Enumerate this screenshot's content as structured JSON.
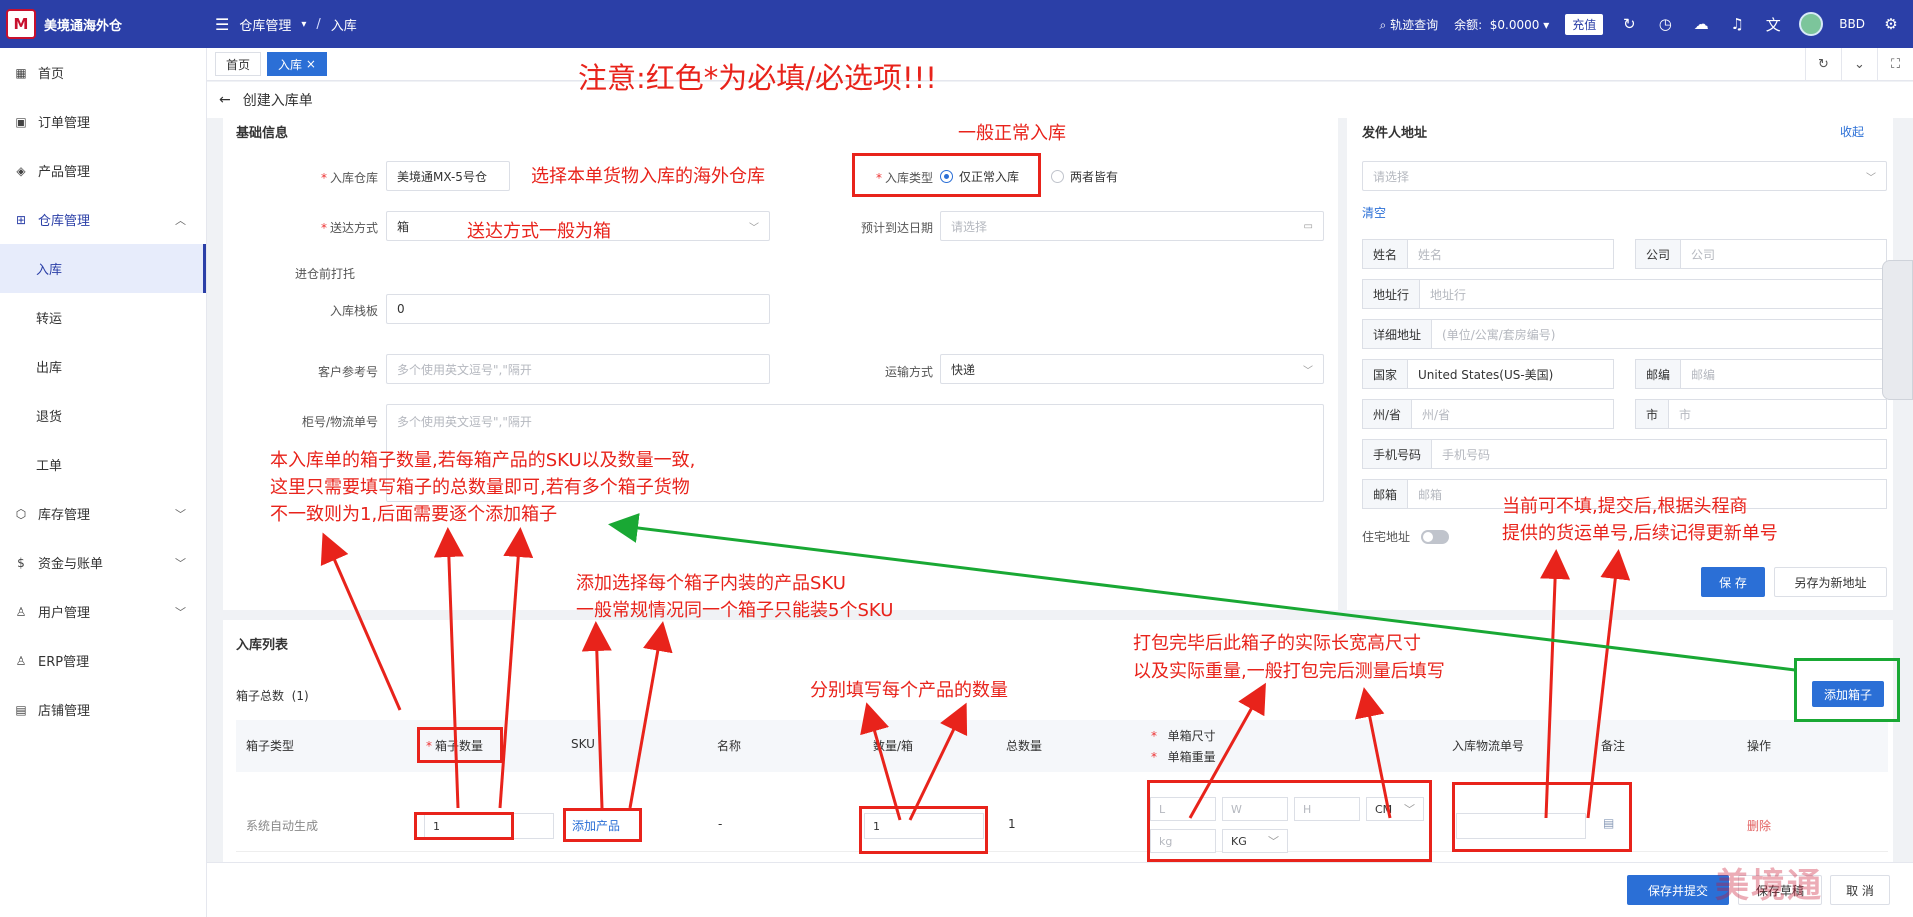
{
  "topbar": {
    "logo_text": "M",
    "brand": "美境通海外仓",
    "breadcrumb": [
      "仓库管理",
      "入库"
    ],
    "track_query": "轨迹查询",
    "balance_label": "余额:",
    "balance_value": "$0.0000",
    "recharge": "充值",
    "user": "BBD"
  },
  "sidebar": {
    "items": [
      {
        "label": "首页",
        "icon": "grid-icon"
      },
      {
        "label": "订单管理",
        "icon": "calendar-icon"
      },
      {
        "label": "产品管理",
        "icon": "box-icon"
      },
      {
        "label": "仓库管理",
        "icon": "warehouse-icon"
      }
    ],
    "sub_items": [
      "入库",
      "转运",
      "出库",
      "退货",
      "工单"
    ],
    "more_items": [
      {
        "label": "库存管理",
        "icon": "cube-icon"
      },
      {
        "label": "资金与账单",
        "icon": "dollar-icon"
      },
      {
        "label": "用户管理",
        "icon": "user-icon"
      },
      {
        "label": "ERP管理",
        "icon": "user-icon"
      },
      {
        "label": "店铺管理",
        "icon": "store-icon"
      }
    ]
  },
  "tabs": [
    "首页",
    "入库"
  ],
  "page_title": "创建入库单",
  "basic": {
    "title": "基础信息",
    "warehouse_label": "入库仓库",
    "warehouse_value": "美境通MX-5号仓",
    "type_label": "入库类型",
    "type_options": [
      "仅正常入库",
      "两者皆有"
    ],
    "delivery_label": "送达方式",
    "delivery_value": "箱",
    "eta_label": "预计到达日期",
    "eta_placeholder": "请选择",
    "pallet_section": "进仓前打托",
    "pallet_label": "入库栈板",
    "pallet_value": "0",
    "ref_label": "客户参考号",
    "ref_placeholder": "多个使用英文逗号\",\"隔开",
    "transport_label": "运输方式",
    "transport_value": "快递",
    "tracking_label": "柜号/物流单号",
    "tracking_placeholder": "多个使用英文逗号\",\"隔开"
  },
  "sender": {
    "title": "发件人地址",
    "collapse": "收起",
    "select_placeholder": "请选择",
    "clear": "清空",
    "name_label": "姓名",
    "name_ph": "姓名",
    "company_label": "公司",
    "company_ph": "公司",
    "addr_label": "地址行",
    "addr_ph": "地址行",
    "detail_label": "详细地址",
    "detail_ph": "(单位/公寓/套房编号)",
    "country_label": "国家",
    "country_value": "United States(US-美国)",
    "zip_label": "邮编",
    "zip_ph": "邮编",
    "state_label": "州/省",
    "state_ph": "州/省",
    "city_label": "市",
    "city_ph": "市",
    "phone_label": "手机号码",
    "phone_ph": "手机号码",
    "email_label": "邮箱",
    "email_ph": "邮箱",
    "residential_label": "住宅地址",
    "save": "保 存",
    "save_new": "另存为新地址"
  },
  "list": {
    "title": "入库列表",
    "box_total_label": "箱子总数",
    "box_total_value": "(1)",
    "add_box": "添加箱子",
    "headers": {
      "box_type": "箱子类型",
      "box_qty": "箱子数量",
      "sku": "SKU",
      "name": "名称",
      "qty_per_box": "数量/箱",
      "total_qty": "总数量",
      "box_size": "单箱尺寸",
      "box_weight": "单箱重量",
      "tracking": "入库物流单号",
      "remark": "备注",
      "action": "操作"
    },
    "row": {
      "box_type": "系统自动生成",
      "box_qty": "1",
      "add_product": "添加产品",
      "name": "-",
      "qty_per_box": "1",
      "total_qty": "1",
      "l_ph": "L",
      "w_ph": "W",
      "h_ph": "H",
      "unit": "CM",
      "kg_ph": "kg",
      "weight_unit": "KG",
      "delete": "删除"
    }
  },
  "bottom": {
    "submit": "保存并提交",
    "draft": "保存草稿",
    "cancel": "取 消",
    "watermark": "美境通"
  },
  "annotations": {
    "notice": "注意:红色*为必填/必选项!!!",
    "normal_inbound": "一般正常入库",
    "select_warehouse": "选择本单货物入库的海外仓库",
    "delivery_box": "送达方式一般为箱",
    "box_count_1": "本入库单的箱子数量,若每箱产品的SKU以及数量一致,",
    "box_count_2": "这里只需要填写箱子的总数量即可,若有多个箱子货物",
    "box_count_3": "不一致则为1,后面需要逐个添加箱子",
    "sku_1": "添加选择每个箱子内装的产品SKU",
    "sku_2": "一般常规情况同一个箱子只能装5个SKU",
    "qty_each": "分别填写每个产品的数量",
    "size_1": "打包完毕后此箱子的实际长宽高尺寸",
    "size_2": "以及实际重量,一般打包完后测量后填写",
    "tracking_1": "当前可不填,提交后,根据头程商",
    "tracking_2": "提供的货运单号,后续记得更新单号"
  }
}
